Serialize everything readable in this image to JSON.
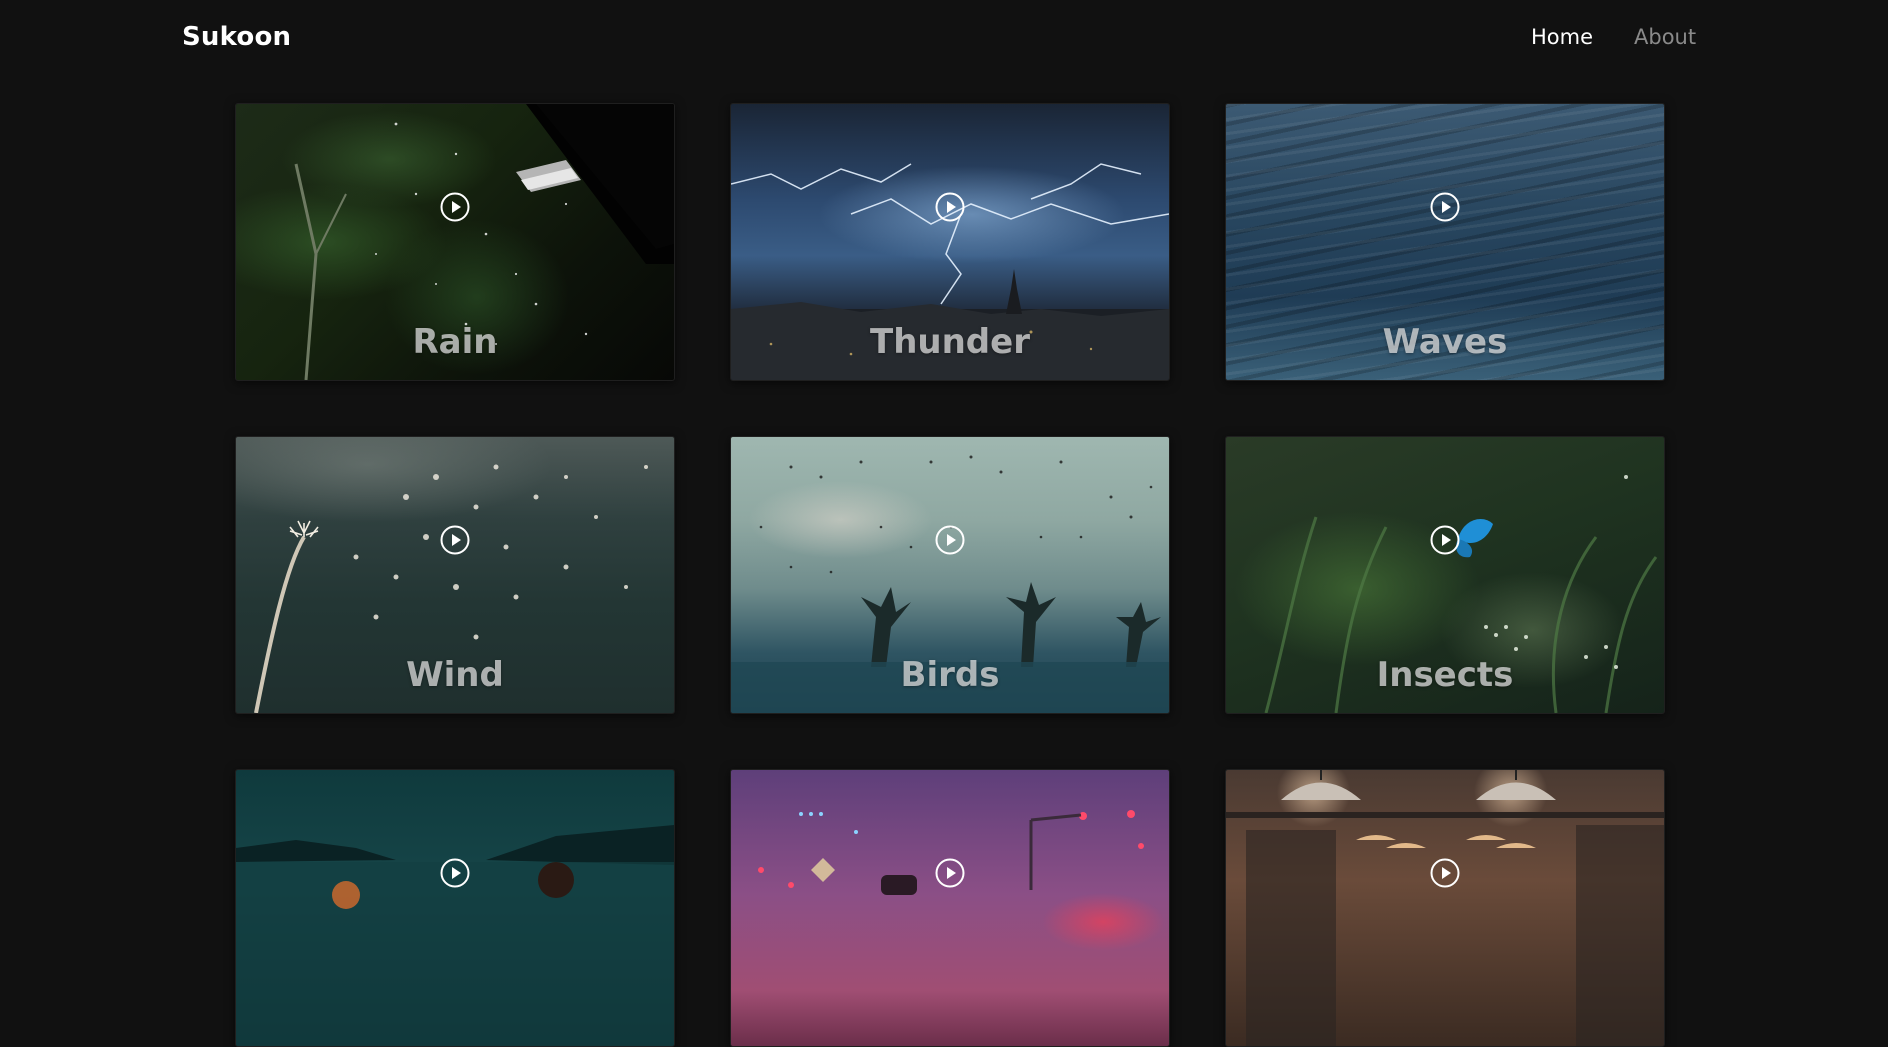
{
  "nav": {
    "brand": "Sukoon",
    "links": [
      "Home",
      "About"
    ]
  },
  "colors": {
    "background": "#111111",
    "nav_active": "#ffffff",
    "nav_inactive": "#8a8a8a"
  },
  "cards": [
    {
      "title": "Rain"
    },
    {
      "title": "Thunder"
    },
    {
      "title": "Waves"
    },
    {
      "title": "Wind"
    },
    {
      "title": "Birds"
    },
    {
      "title": "Insects"
    },
    {
      "title": ""
    },
    {
      "title": ""
    },
    {
      "title": ""
    }
  ],
  "icons": {
    "play": "play-circle-icon"
  }
}
